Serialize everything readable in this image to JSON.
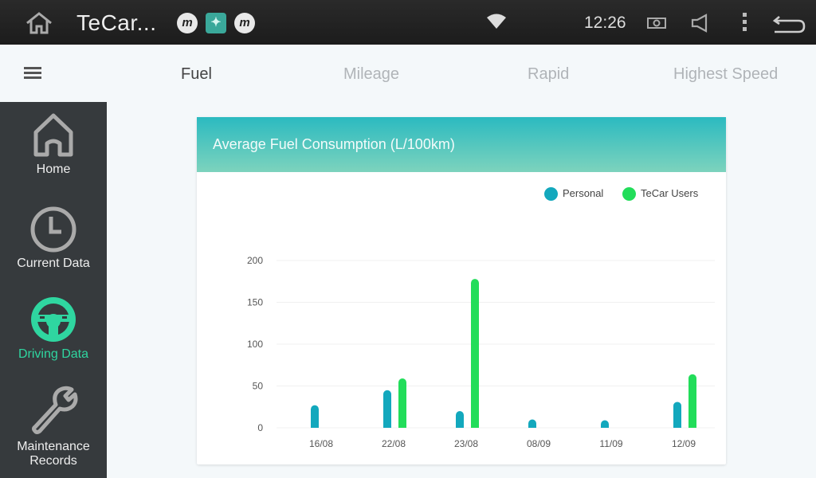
{
  "status_bar": {
    "app_title": "TeCar...",
    "time": "12:26",
    "notification_icons": [
      "m-app-icon",
      "teal-app-icon",
      "m-app-icon"
    ],
    "icons": [
      "home-icon",
      "wifi-icon",
      "camera-icon",
      "volume-icon",
      "more-icon",
      "back-icon"
    ]
  },
  "tabs": [
    {
      "label": "Fuel",
      "active": true
    },
    {
      "label": "Mileage",
      "active": false
    },
    {
      "label": "Rapid",
      "active": false
    },
    {
      "label": "Highest Speed",
      "active": false
    }
  ],
  "sidebar": {
    "items": [
      {
        "label": "Home",
        "icon": "home-icon",
        "active": false
      },
      {
        "label": "Current Data",
        "icon": "clock-icon",
        "active": false
      },
      {
        "label": "Driving Data",
        "icon": "steering-wheel-icon",
        "active": true
      },
      {
        "label": "Maintenance Records",
        "label_line1": "Maintenance",
        "label_line2": "Records",
        "icon": "wrench-icon",
        "active": false
      }
    ]
  },
  "colors": {
    "accent": "#2fd6a0",
    "personal": "#13a8bd",
    "tecar_users": "#22dd5a"
  },
  "chart_data": {
    "type": "bar",
    "title": "Average Fuel Consumption (L/100km)",
    "xlabel": "",
    "ylabel": "",
    "categories": [
      "16/08",
      "22/08",
      "23/08",
      "08/09",
      "11/09",
      "12/09"
    ],
    "series": [
      {
        "name": "Personal",
        "color": "#13a8bd",
        "values": [
          27,
          45,
          20,
          10,
          9,
          31
        ]
      },
      {
        "name": "TeCar Users",
        "color": "#22dd5a",
        "values": [
          0,
          59,
          178,
          0,
          0,
          64
        ]
      }
    ],
    "yticks": [
      0,
      50,
      100,
      150,
      200
    ],
    "ylim": [
      0,
      200
    ],
    "grid": true,
    "legend_position": "top-right"
  }
}
